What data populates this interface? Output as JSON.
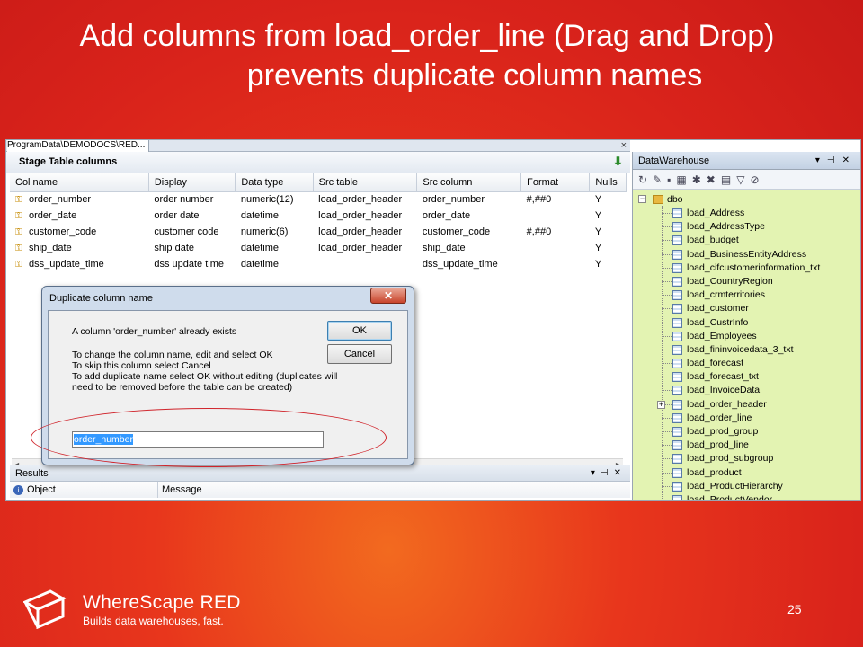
{
  "slide": {
    "title_line1": "Add columns from load_order_line (Drag and Drop)",
    "title_line2": "prevents duplicate column names",
    "page_number": "25"
  },
  "footer": {
    "brand": "WhereScape RED",
    "tagline": "Builds data warehouses, fast."
  },
  "app": {
    "doc_tab": "ProgramData\\DEMODOCS\\RED...",
    "close_glyph": "×",
    "stage_table": {
      "header": "Stage Table columns",
      "columns": [
        "Col name",
        "Display",
        "Data type",
        "Src table",
        "Src column",
        "Format",
        "Nulls"
      ],
      "rows": [
        [
          "order_number",
          "order number",
          "numeric(12)",
          "load_order_header",
          "order_number",
          "#,##0",
          "Y"
        ],
        [
          "order_date",
          "order date",
          "datetime",
          "load_order_header",
          "order_date",
          "",
          "Y"
        ],
        [
          "customer_code",
          "customer code",
          "numeric(6)",
          "load_order_header",
          "customer_code",
          "#,##0",
          "Y"
        ],
        [
          "ship_date",
          "ship date",
          "datetime",
          "load_order_header",
          "ship_date",
          "",
          "Y"
        ],
        [
          "dss_update_time",
          "dss update time",
          "datetime",
          "",
          "dss_update_time",
          "",
          "Y"
        ]
      ]
    },
    "results": {
      "title": "Results",
      "col_object": "Object",
      "col_message": "Message"
    },
    "datawarehouse": {
      "title": "DataWarehouse",
      "root": "dbo",
      "items": [
        "load_Address",
        "load_AddressType",
        "load_budget",
        "load_BusinessEntityAddress",
        "load_cifcustomerinformation_txt",
        "load_CountryRegion",
        "load_crmterritories",
        "load_customer",
        "load_CustrInfo",
        "load_Employees",
        "load_fininvoicedata_3_txt",
        "load_forecast",
        "load_forecast_txt",
        "load_InvoiceData",
        "load_order_header",
        "load_order_line",
        "load_prod_group",
        "load_prod_line",
        "load_prod_subgroup",
        "load_product",
        "load_ProductHierarchy",
        "load_ProductVendor"
      ]
    },
    "dialog": {
      "title": "Duplicate column name",
      "message": "A column 'order_number' already exists",
      "instructions": "To change the column name, edit and select OK\nTo skip this column select Cancel\nTo add duplicate name select OK without editing (duplicates will need to be removed before the table can be created)",
      "ok_label": "OK",
      "cancel_label": "Cancel",
      "input_value": "order_number"
    }
  }
}
